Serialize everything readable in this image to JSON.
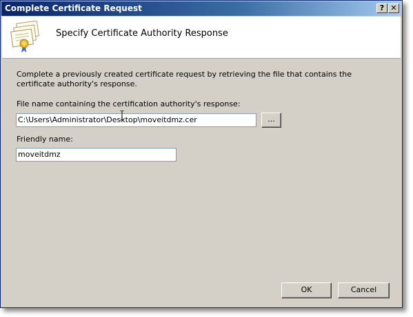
{
  "window": {
    "title": "Complete Certificate Request",
    "help_label": "?",
    "close_label": "✕"
  },
  "header": {
    "title": "Specify Certificate Authority Response",
    "icon": "certificate-icon"
  },
  "body": {
    "description": "Complete a previously created certificate request by retrieving the file that contains the certificate authority's response.",
    "file_label": "File name containing the certification authority's response:",
    "file_value": "C:\\Users\\Administrator\\Desktop\\moveitdmz.cer",
    "browse_label": "...",
    "friendly_label": "Friendly name:",
    "friendly_value": "moveitdmz"
  },
  "footer": {
    "ok_label": "OK",
    "cancel_label": "Cancel"
  }
}
